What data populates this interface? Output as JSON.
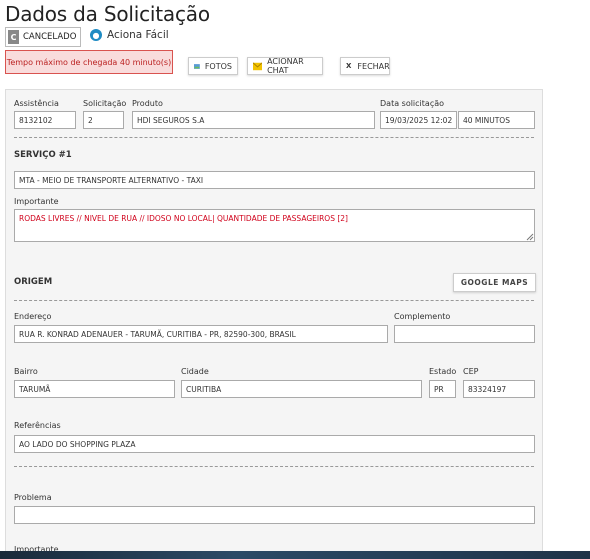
{
  "page_title": "Dados da Solicitação",
  "status": {
    "letter": "C",
    "label": "CANCELADO"
  },
  "brand": {
    "label": "Aciona Fácil",
    "icon": "location-icon"
  },
  "alert": "Tempo máximo de chegada 40 minuto(s)",
  "toolbar": {
    "photos": "FOTOS",
    "chat": "ACIONAR CHAT",
    "close": "FECHAR",
    "close_icon": "X"
  },
  "request": {
    "assistencia_label": "Assistência",
    "assistencia": "8132102",
    "solicitacao_label": "Solicitação",
    "solicitacao": "2",
    "produto_label": "Produto",
    "produto": "HDI SEGUROS S.A",
    "data_label": "Data solicitação",
    "data": "19/03/2025 12:02",
    "tempo": "40 MINUTOS"
  },
  "service": {
    "title": "SERVIÇO #1",
    "type": "MTA - MEIO DE TRANSPORTE ALTERNATIVO - TAXI",
    "important_label": "Importante",
    "important": "RODAS LIVRES // NIVEL DE RUA // IDOSO NO LOCAL| QUANTIDADE DE PASSAGEIROS [2]"
  },
  "origin": {
    "title": "ORIGEM",
    "maps_button": "GOOGLE MAPS",
    "endereco_label": "Endereço",
    "endereco": "RUA R. KONRAD ADENAUER - TARUMÃ, CURITIBA - PR, 82590-300, BRASIL",
    "complemento_label": "Complemento",
    "complemento": "",
    "bairro_label": "Bairro",
    "bairro": "TARUMÃ",
    "cidade_label": "Cidade",
    "cidade": "CURITIBA",
    "estado_label": "Estado",
    "estado": "PR",
    "cep_label": "CEP",
    "cep": "83324197",
    "referencias_label": "Referências",
    "referencias": "AO LADO DO SHOPPING PLAZA"
  },
  "problem": {
    "label": "Problema",
    "value": "",
    "important_label": "Importante"
  },
  "colors": {
    "alert_bg": "#f9dcdc",
    "alert_border": "#d9534f",
    "important_text": "#d0021b",
    "brand_icon": "#1e8bc3"
  }
}
